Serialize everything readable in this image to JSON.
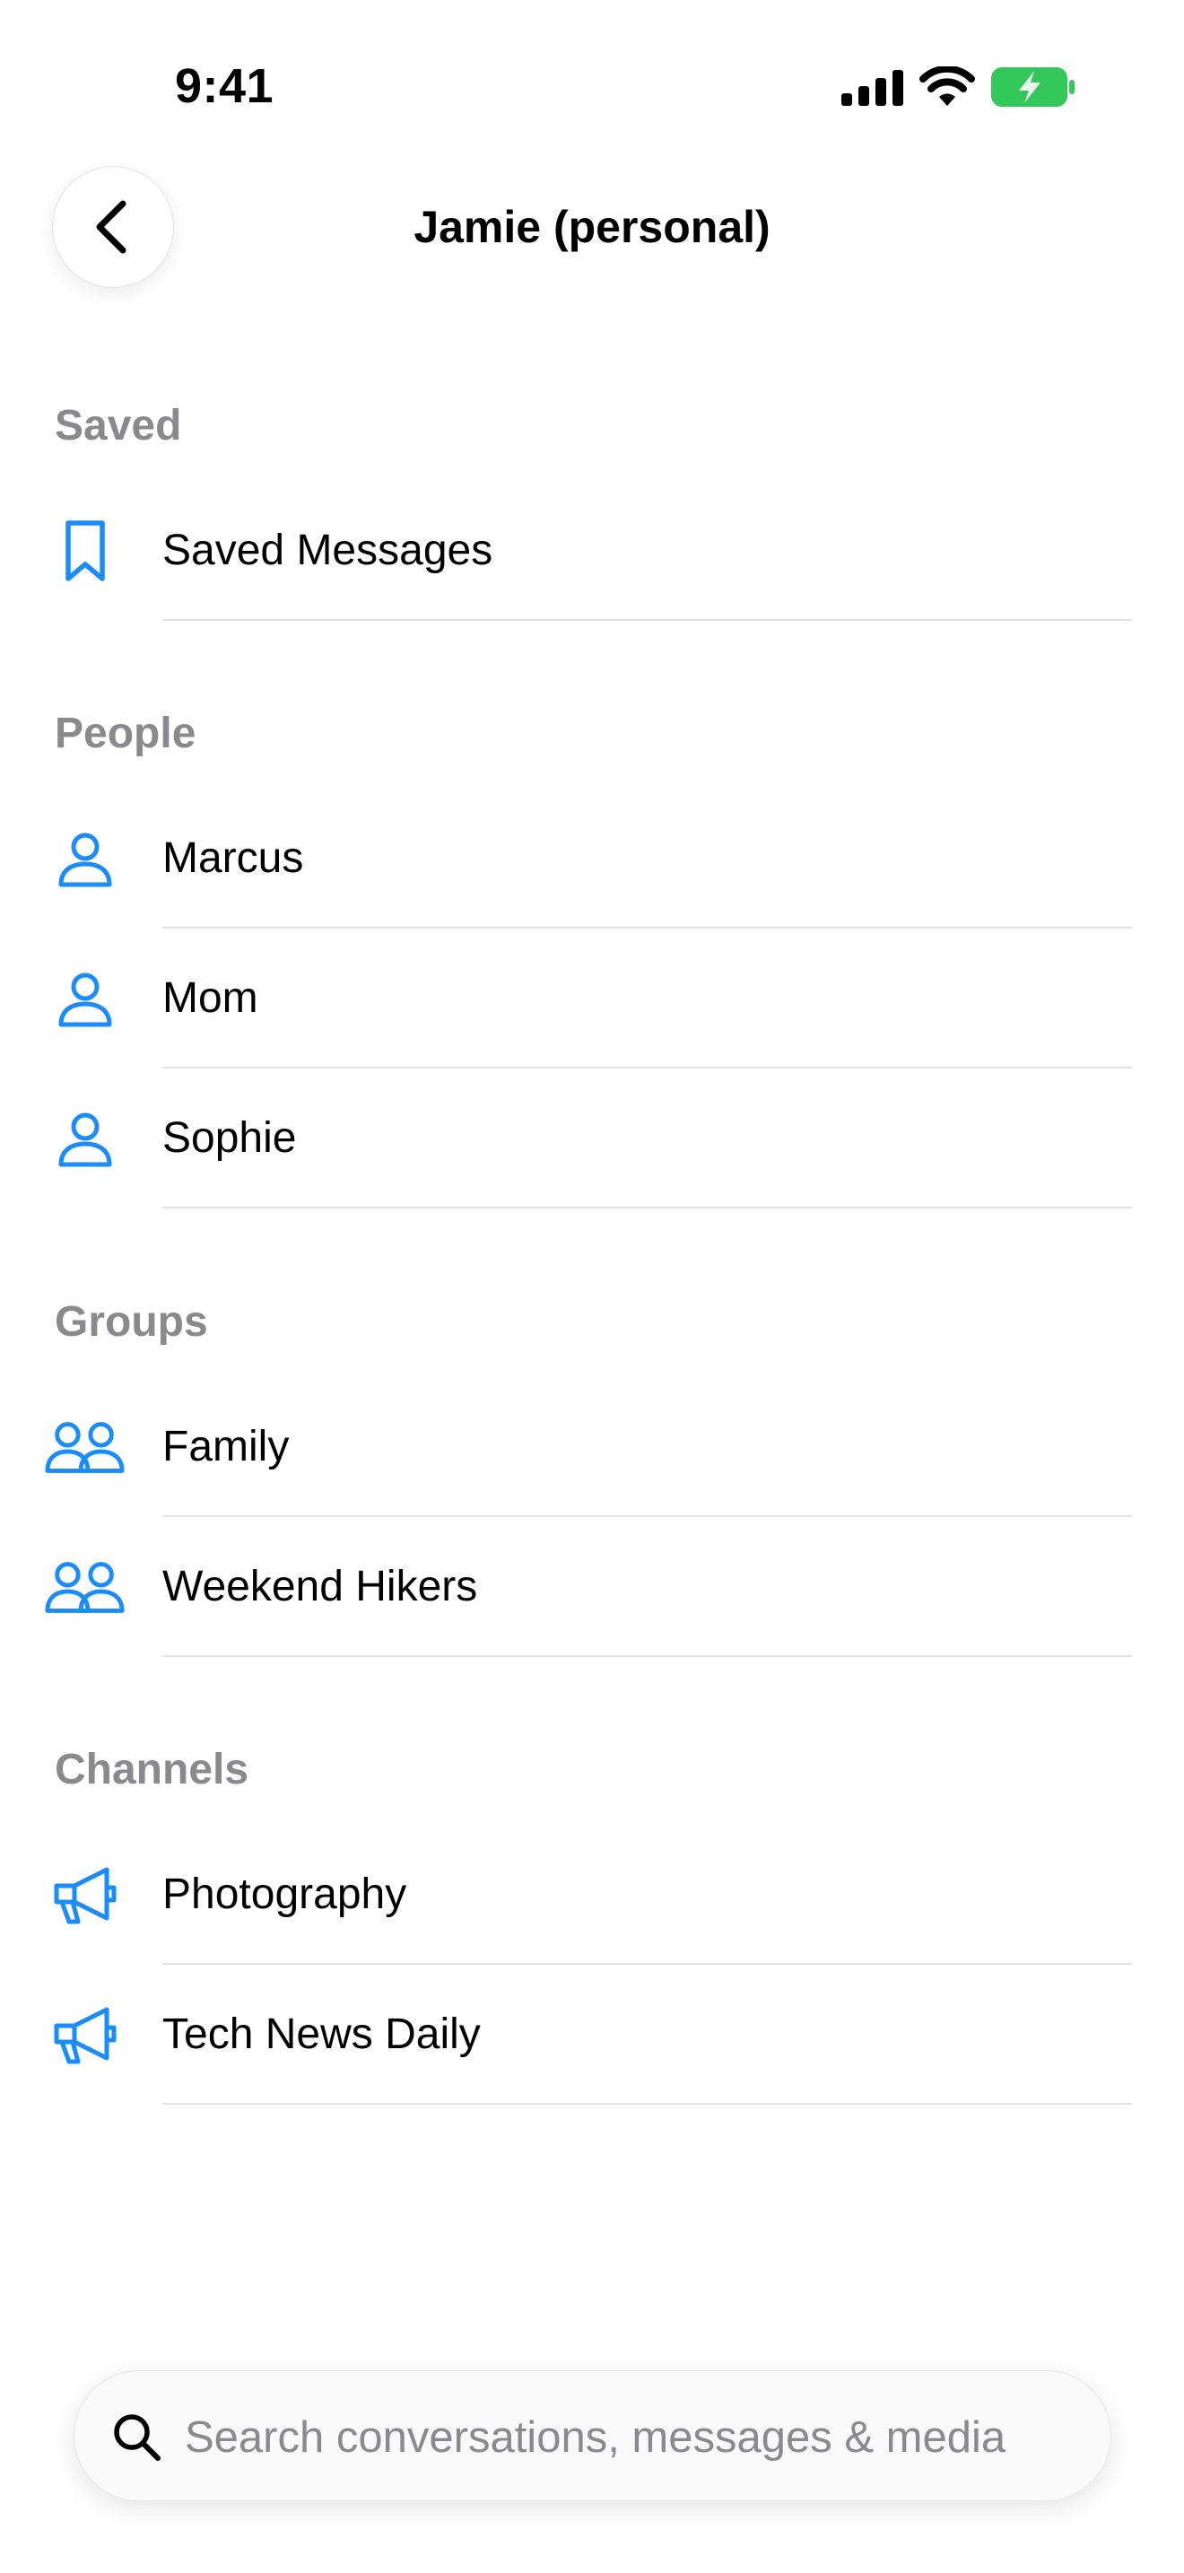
{
  "status_bar": {
    "time": "9:41",
    "icons": [
      "cellular-signal-icon",
      "wifi-icon",
      "battery-charging-icon"
    ],
    "battery_color": "#34c759"
  },
  "header": {
    "back_icon": "chevron-left-icon",
    "title": "Jamie (personal)"
  },
  "accent_color": "#1a8cff",
  "sections": [
    {
      "title": "Saved",
      "items": [
        {
          "label": "Saved Messages",
          "icon": "bookmark-icon"
        }
      ]
    },
    {
      "title": "People",
      "items": [
        {
          "label": "Marcus",
          "icon": "person-icon"
        },
        {
          "label": "Mom",
          "icon": "person-icon"
        },
        {
          "label": "Sophie",
          "icon": "person-icon"
        }
      ]
    },
    {
      "title": "Groups",
      "items": [
        {
          "label": "Family",
          "icon": "group-icon"
        },
        {
          "label": "Weekend Hikers",
          "icon": "group-icon"
        }
      ]
    },
    {
      "title": "Channels",
      "items": [
        {
          "label": "Photography",
          "icon": "megaphone-icon"
        },
        {
          "label": "Tech News Daily",
          "icon": "megaphone-icon"
        }
      ]
    }
  ],
  "search": {
    "placeholder": "Search conversations, messages & media",
    "icon": "search-icon"
  }
}
